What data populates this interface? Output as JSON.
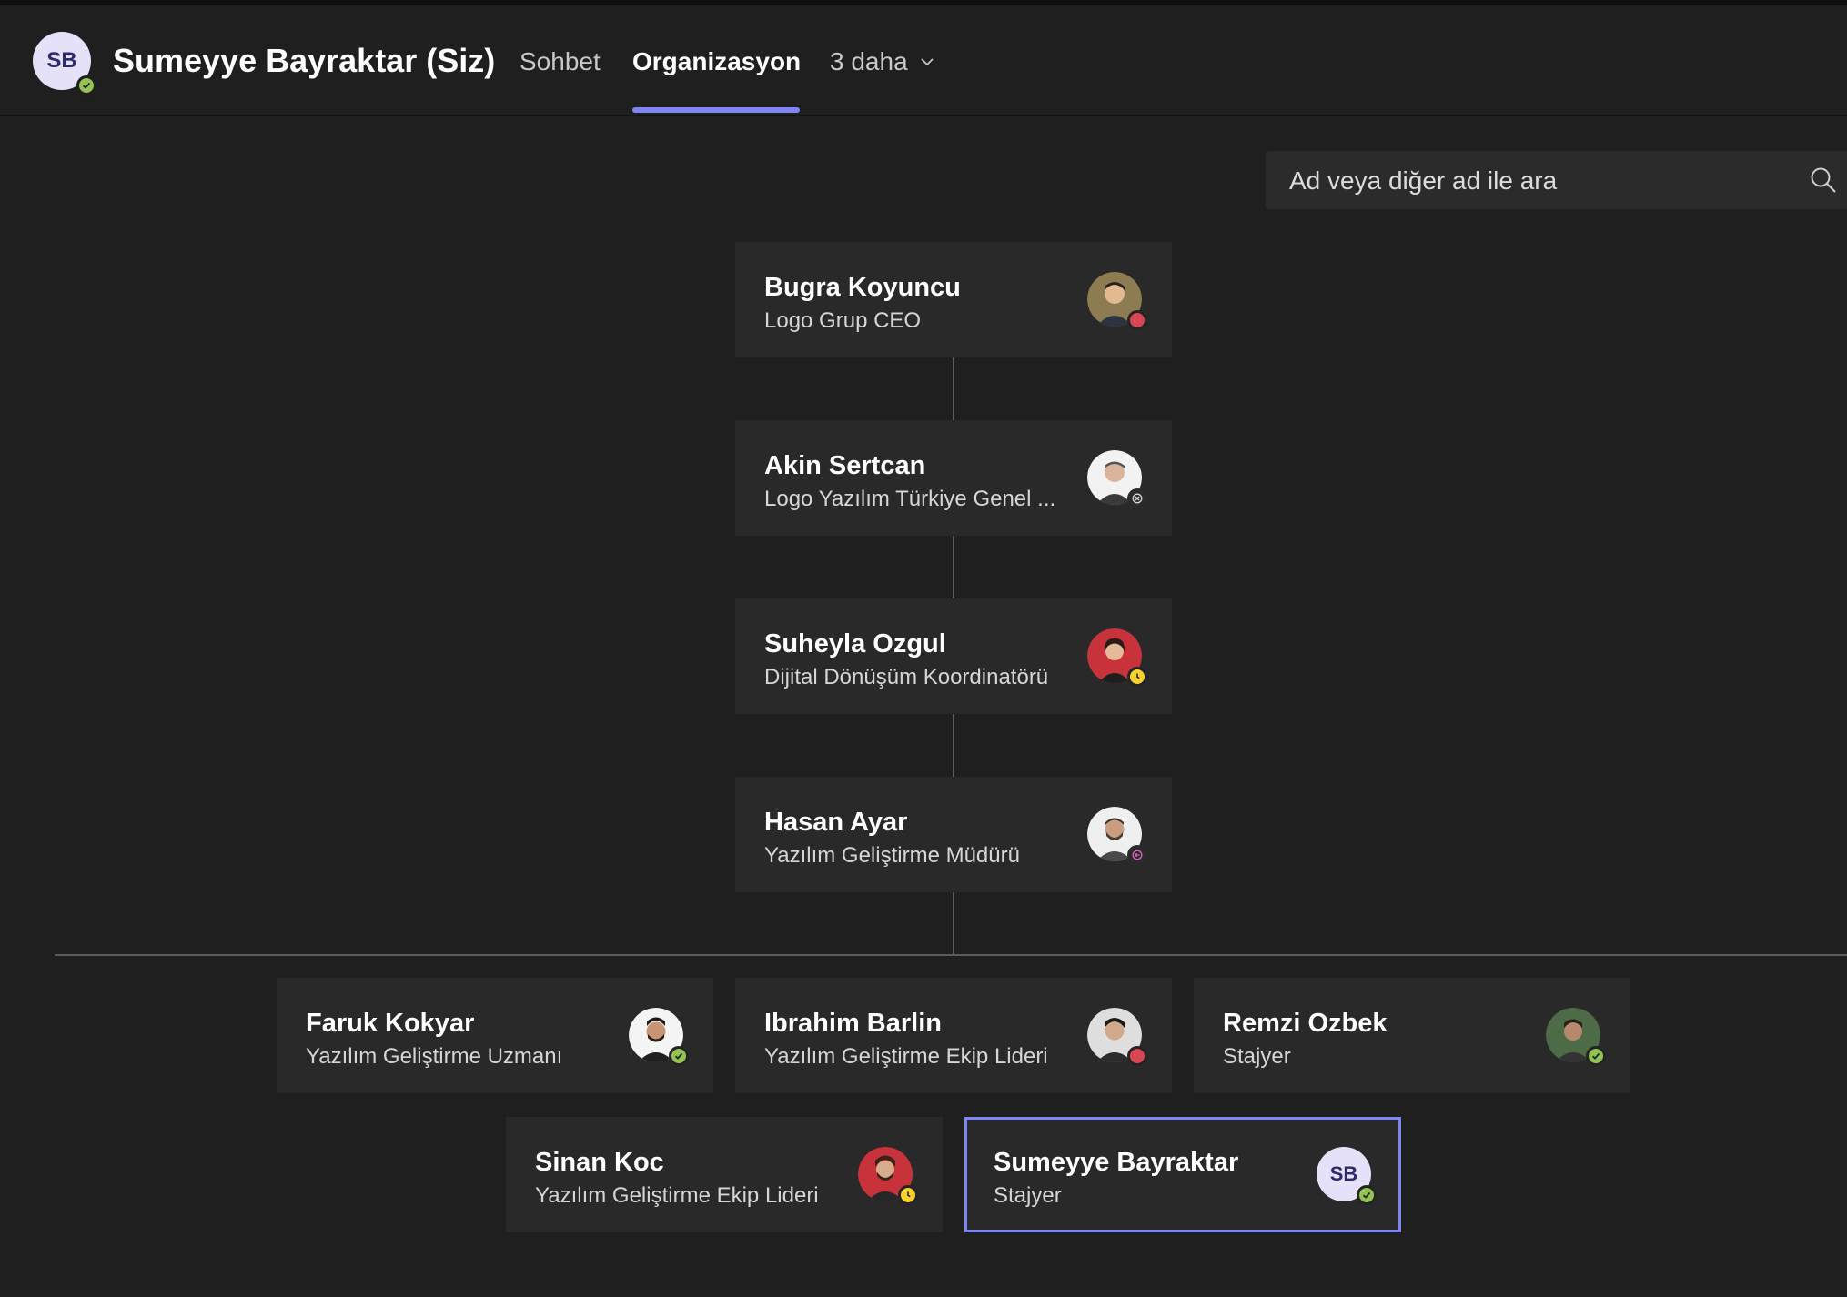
{
  "header": {
    "avatar_initials": "SB",
    "title": "Sumeyye Bayraktar (Siz)",
    "tabs": [
      {
        "label": "Sohbet"
      },
      {
        "label": "Organizasyon"
      },
      {
        "label": "3 daha"
      }
    ],
    "active_tab": "Organizasyon",
    "presence": "available"
  },
  "search": {
    "placeholder": "Ad veya diğer ad ile ara"
  },
  "org": {
    "chain": [
      {
        "name": "Bugra Koyuncu",
        "title": "Logo Grup CEO",
        "presence": "busy"
      },
      {
        "name": "Akin Sertcan",
        "title": "Logo Yazılım Türkiye Genel ...",
        "presence": "offline"
      },
      {
        "name": "Suheyla Ozgul",
        "title": "Dijital Dönüşüm Koordinatörü",
        "presence": "away"
      },
      {
        "name": "Hasan Ayar",
        "title": "Yazılım Geliştirme Müdürü",
        "presence": "out-of-office"
      }
    ],
    "reports": [
      {
        "name": "Faruk Kokyar",
        "title": "Yazılım Geliştirme Uzmanı",
        "presence": "available"
      },
      {
        "name": "Ibrahim Barlin",
        "title": "Yazılım Geliştirme Ekip Lideri",
        "presence": "busy"
      },
      {
        "name": "Remzi Ozbek",
        "title": "Stajyer",
        "presence": "available"
      },
      {
        "name": "Sinan Koc",
        "title": "Yazılım Geliştirme Ekip Lideri",
        "presence": "away"
      },
      {
        "name": "Sumeyye Bayraktar",
        "title": "Stajyer",
        "presence": "available",
        "initials": "SB",
        "selected": true
      }
    ]
  },
  "colors": {
    "background": "#1f1f1f",
    "card": "#292929",
    "accent": "#7f85f5",
    "available": "#92c353",
    "busy": "#d74654",
    "away": "#f8d22a",
    "out_of_office": "#b4009e"
  }
}
